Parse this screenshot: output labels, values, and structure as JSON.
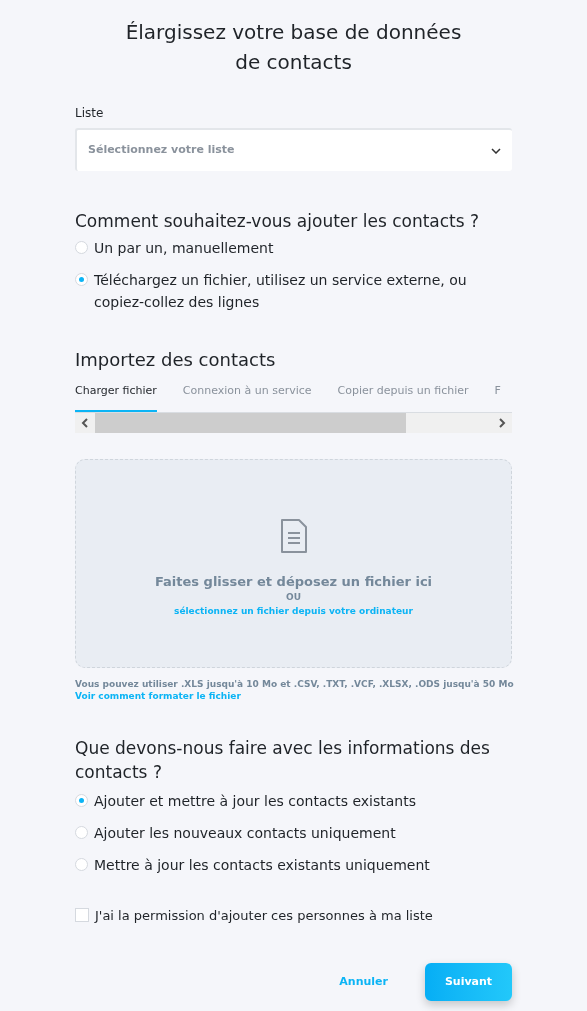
{
  "title": "Élargissez votre base de données de contacts",
  "list_field": {
    "label": "Liste",
    "placeholder": "Sélectionnez votre liste"
  },
  "add_method": {
    "heading": "Comment souhaitez-vous ajouter les contacts ?",
    "options": [
      {
        "label": "Un par un, manuellement",
        "selected": false
      },
      {
        "label": "Téléchargez un fichier, utilisez un service externe, ou copiez-collez des lignes",
        "selected": true
      }
    ]
  },
  "import": {
    "heading": "Importez des contacts",
    "tabs": [
      {
        "label": "Charger fichier",
        "selected": true
      },
      {
        "label": "Connexion à un service",
        "selected": false
      },
      {
        "label": "Copier depuis un fichier",
        "selected": false
      },
      {
        "label": "F",
        "selected": false
      }
    ],
    "dropzone": {
      "title": "Faites glisser et déposez un fichier ici",
      "separator": "OU",
      "link": "sélectionnez un fichier depuis votre ordinateur"
    },
    "hint": "Vous pouvez utiliser .XLS jusqu'à 10 Mo et .CSV, .TXT, .VCF, .XLSX, .ODS jusqu'à 50 Mo",
    "help_link": "Voir comment formater le fichier"
  },
  "update_mode": {
    "heading": "Que devons-nous faire avec les informations des contacts ?",
    "options": [
      {
        "label": "Ajouter et mettre à jour les contacts existants",
        "selected": true
      },
      {
        "label": "Ajouter les nouveaux contacts uniquement",
        "selected": false
      },
      {
        "label": "Mettre à jour les contacts existants uniquement",
        "selected": false
      }
    ]
  },
  "permission": {
    "label": "J'ai la permission d'ajouter ces personnes à ma liste",
    "checked": false
  },
  "buttons": {
    "cancel": "Annuler",
    "next": "Suivant"
  }
}
